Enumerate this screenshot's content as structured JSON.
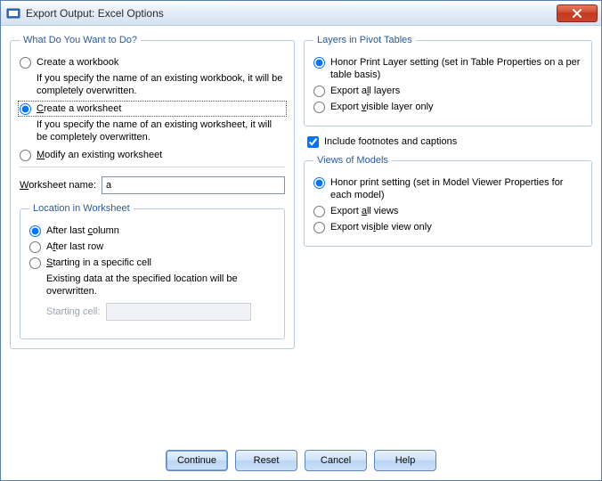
{
  "window": {
    "title": "Export Output: Excel Options"
  },
  "wywd": {
    "legend": "What Do You Want to Do?",
    "create_workbook_label": "Create a workbook",
    "create_workbook_desc": "If you specify the name of an existing workbook, it will be completely overwritten.",
    "create_worksheet_label": "Create a worksheet",
    "create_worksheet_desc": "If you specify the name of an existing worksheet, it will be completely overwritten.",
    "modify_worksheet_label": "Modify an existing worksheet"
  },
  "worksheet": {
    "label": "Worksheet name:",
    "value": "a"
  },
  "location": {
    "legend": "Location in Worksheet",
    "after_last_column": "After last column",
    "after_last_row": "After last row",
    "starting_cell": "Starting in a specific cell",
    "starting_cell_desc": "Existing data at the specified location will be overwritten.",
    "starting_cell_label": "Starting cell:",
    "starting_cell_value": ""
  },
  "layers": {
    "legend": "Layers in Pivot Tables",
    "honor_print": "Honor Print Layer setting (set in Table Properties on a per table basis)",
    "export_all": "Export all layers",
    "export_visible": "Export visible layer only"
  },
  "footnotes": {
    "label": "Include footnotes and captions"
  },
  "views": {
    "legend": "Views of Models",
    "honor_print": "Honor print setting (set in Model Viewer Properties for each model)",
    "export_all": "Export all views",
    "export_visible": "Export visible view only"
  },
  "buttons": {
    "continue": "Continue",
    "reset": "Reset",
    "cancel": "Cancel",
    "help": "Help"
  }
}
